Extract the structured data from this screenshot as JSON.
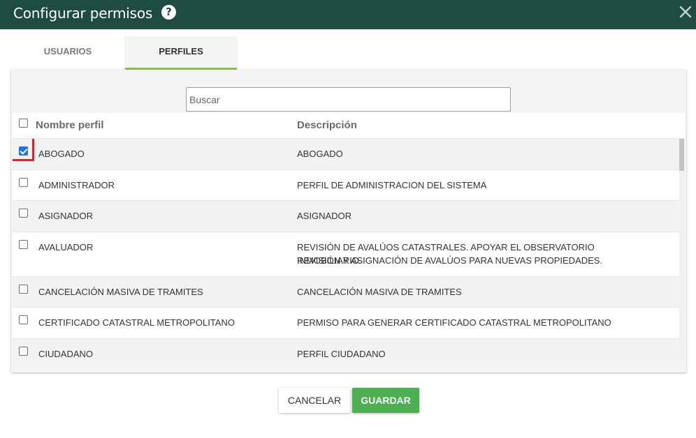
{
  "dialog": {
    "title": "Configurar permisos",
    "help_icon": "question-circle-icon",
    "help_glyph": "?",
    "close_icon": "close-x-icon"
  },
  "tabs": [
    {
      "label": "USUARIOS",
      "active": false
    },
    {
      "label": "PERFILES",
      "active": true
    }
  ],
  "search": {
    "placeholder": "Buscar",
    "value": ""
  },
  "table": {
    "columns": {
      "name": "Nombre perfil",
      "description": "Descripción"
    },
    "rows": [
      {
        "name": "ABOGADO",
        "description": "ABOGADO",
        "checked": true
      },
      {
        "name": "ADMINISTRADOR",
        "description": "PERFIL DE ADMINISTRACION DEL SISTEMA",
        "checked": false
      },
      {
        "name": "ASIGNADOR",
        "description": "ASIGNADOR",
        "checked": false
      },
      {
        "name": "AVALUADOR",
        "description_lines": [
          "REVISIÓN DE AVALÚOS CATASTRALES. APOYAR EL OBSERVATORIO INMOBILIARIO.",
          "REVISIÓN Y ASIGNACIÓN DE AVALÚOS PARA NUEVAS PROPIEDADES."
        ],
        "checked": false
      },
      {
        "name": "CANCELACIÓN MASIVA DE TRAMITES",
        "description": "CANCELACIÓN MASIVA DE TRAMITES",
        "checked": false
      },
      {
        "name": "CERTIFICADO CATASTRAL METROPOLITANO",
        "description": "PERMISO PARA GENERAR CERTIFICADO CATASTRAL METROPOLITANO",
        "checked": false
      },
      {
        "name": "CIUDADANO",
        "description": "PERFIL CIUDADANO",
        "checked": false
      }
    ]
  },
  "buttons": {
    "cancel": "CANCELAR",
    "save": "GUARDAR"
  },
  "colors": {
    "header": "#1e4d3f",
    "tab_underline": "#8bc34a",
    "save_button": "#4caf50",
    "highlight": "#e0202a",
    "checkbox": "#1a73e8"
  }
}
